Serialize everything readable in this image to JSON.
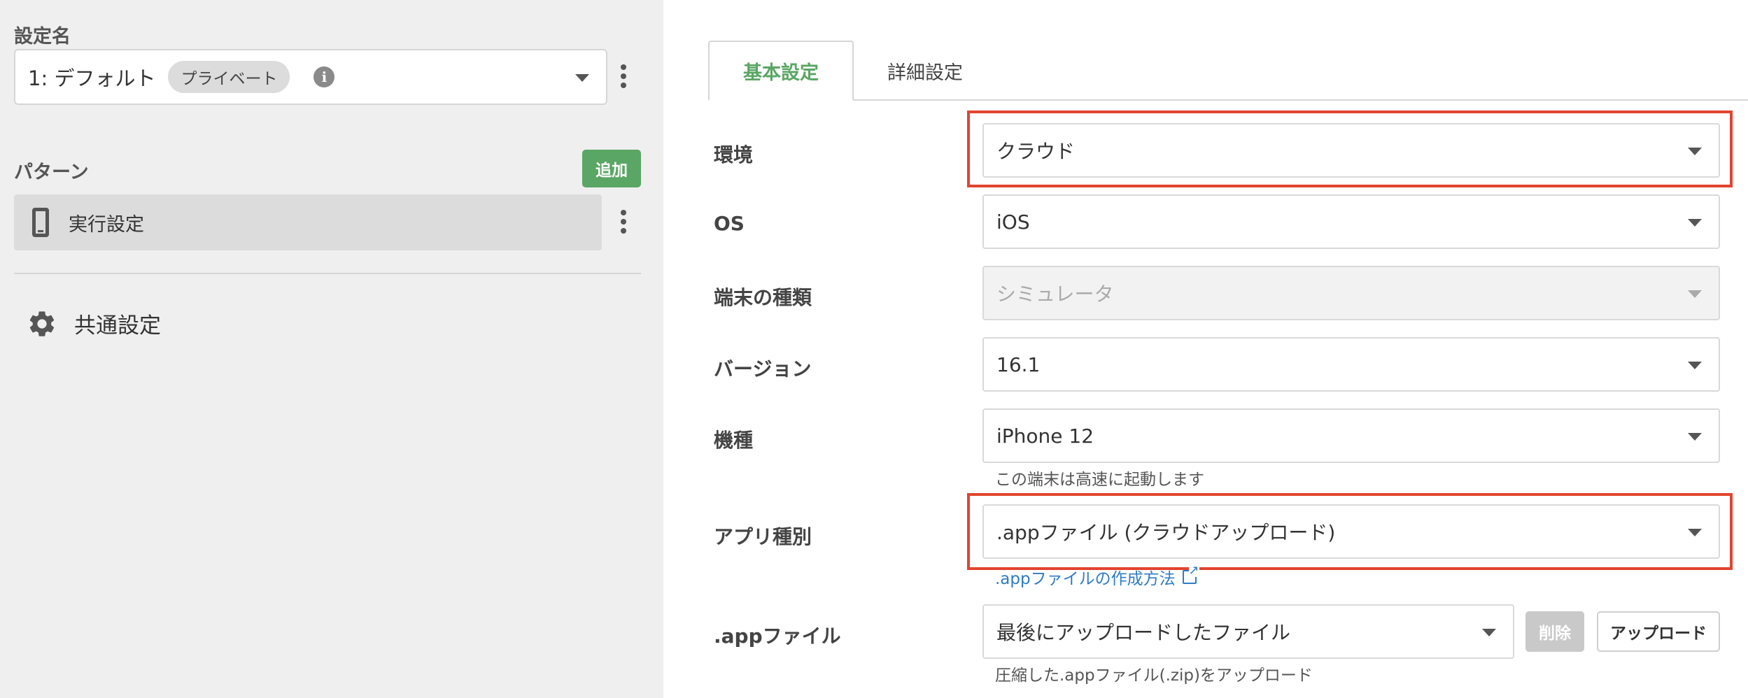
{
  "sidebar": {
    "settings_label": "設定名",
    "config": {
      "name": "1: デフォルト",
      "badge": "プライベート",
      "info_icon": "i"
    },
    "pattern_label": "パターン",
    "add_button": "追加",
    "pattern_item": "実行設定",
    "common_settings": "共通設定"
  },
  "tabs": [
    {
      "label": "基本設定",
      "active": true
    },
    {
      "label": "詳細設定",
      "active": false
    }
  ],
  "form": {
    "environment": {
      "label": "環境",
      "value": "クラウド"
    },
    "os": {
      "label": "OS",
      "value": "iOS"
    },
    "device_type": {
      "label": "端末の種類",
      "value": "シミュレータ",
      "disabled": true
    },
    "version": {
      "label": "バージョン",
      "value": "16.1"
    },
    "model": {
      "label": "機種",
      "value": "iPhone 12",
      "hint": "この端末は高速に起動します"
    },
    "app_type": {
      "label": "アプリ種別",
      "value": ".appファイル (クラウドアップロード)",
      "link": ".appファイルの作成方法"
    },
    "app_file": {
      "label": ".appファイル",
      "value": "最後にアップロードしたファイル",
      "delete_button": "削除",
      "upload_button": "アップロード",
      "hint": "圧縮した.appファイル(.zip)をアップロード"
    }
  },
  "colors": {
    "accent_green": "#5aa664",
    "highlight_red": "#e2442f",
    "link_blue": "#2f7cc4"
  }
}
